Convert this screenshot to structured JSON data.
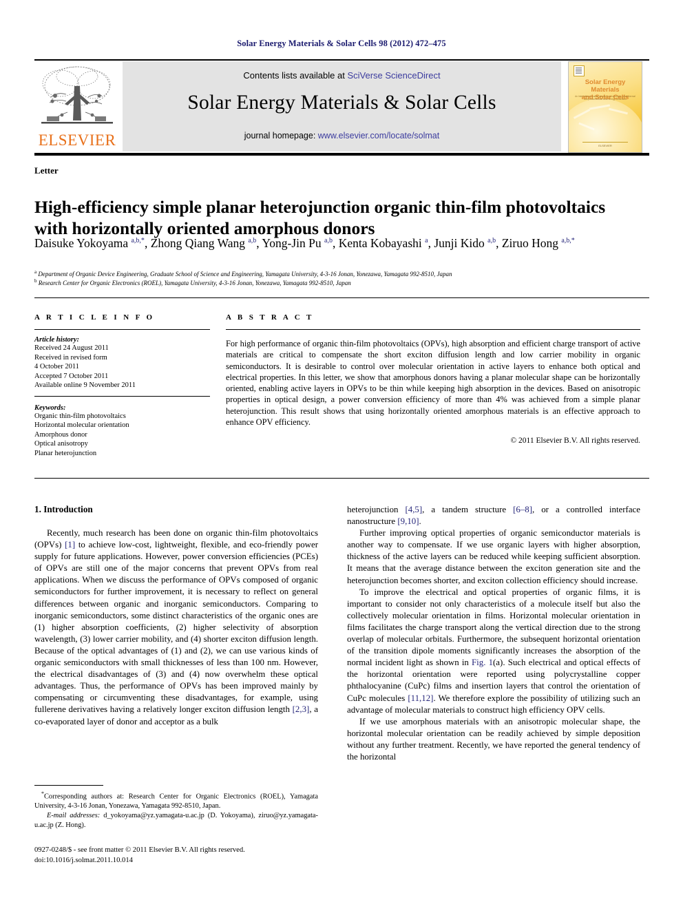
{
  "running_head": "Solar Energy Materials & Solar Cells 98 (2012) 472–475",
  "journal_header": {
    "contents_prefix": "Contents lists available at ",
    "contents_link": "SciVerse ScienceDirect",
    "journal_title": "Solar Energy Materials & Solar Cells",
    "homepage_prefix": "journal homepage: ",
    "homepage_link": "www.elsevier.com/locate/solmat",
    "publisher_wordmark": "ELSEVIER",
    "publisher_color": "#E8701A",
    "link_color": "#3b3b9e",
    "band_color": "#e3e3e3",
    "cover": {
      "title_line1": "Solar Energy Materials",
      "title_line2": "and Solar Cells",
      "subtitle": "An International Journal devoted to photovoltaic, photothermal and photochemical solar energy conversion",
      "footer": "ELSEVIER"
    }
  },
  "article": {
    "type_label": "Letter",
    "title": "High-efficiency simple planar heterojunction organic thin-film photovoltaics with horizontally oriented amorphous donors",
    "authors": [
      {
        "name": "Daisuke Yokoyama",
        "sup": "a,b,*"
      },
      {
        "name": "Zhong Qiang Wang",
        "sup": "a,b"
      },
      {
        "name": "Yong-Jin Pu",
        "sup": "a,b"
      },
      {
        "name": "Kenta Kobayashi",
        "sup": "a"
      },
      {
        "name": "Junji Kido",
        "sup": "a,b"
      },
      {
        "name": "Ziruo Hong",
        "sup": "a,b,*"
      }
    ],
    "affiliations": [
      {
        "marker": "a",
        "text": "Department of Organic Device Engineering, Graduate School of Science and Engineering, Yamagata University, 4-3-16 Jonan, Yonezawa, Yamagata 992-8510, Japan"
      },
      {
        "marker": "b",
        "text": "Research Center for Organic Electronics (ROEL), Yamagata University, 4-3-16 Jonan, Yonezawa, Yamagata 992-8510, Japan"
      }
    ]
  },
  "article_info": {
    "heading": "A R T I C L E   I N F O",
    "history_label": "Article history:",
    "history": [
      "Received 24 August 2011",
      "Received in revised form",
      "4 October 2011",
      "Accepted 7 October 2011",
      "Available online 9 November 2011"
    ],
    "keywords_label": "Keywords:",
    "keywords": [
      "Organic thin-film photovoltaics",
      "Horizontal molecular orientation",
      "Amorphous donor",
      "Optical anisotropy",
      "Planar heterojunction"
    ]
  },
  "abstract": {
    "heading": "A B S T R A C T",
    "text": "For high performance of organic thin-film photovoltaics (OPVs), high absorption and efficient charge transport of active materials are critical to compensate the short exciton diffusion length and low carrier mobility in organic semiconductors. It is desirable to control over molecular orientation in active layers to enhance both optical and electrical properties. In this letter, we show that amorphous donors having a planar molecular shape can be horizontally oriented, enabling active layers in OPVs to be thin while keeping high absorption in the devices. Based on anisotropic properties in optical design, a power conversion efficiency of more than 4% was achieved from a simple planar heterojunction. This result shows that using horizontally oriented amorphous materials is an effective approach to enhance OPV efficiency.",
    "copyright": "© 2011 Elsevier B.V. All rights reserved."
  },
  "body": {
    "section_heading": "1.  Introduction",
    "left_paragraphs": [
      {
        "segments": [
          {
            "t": "Recently, much research has been done on organic thin-film photovoltaics (OPVs) "
          },
          {
            "t": "[1]",
            "ref": true
          },
          {
            "t": " to achieve low-cost, lightweight, flexible, and eco-friendly power supply for future applications. However, power conversion efficiencies (PCEs) of OPVs are still one of the major concerns that prevent OPVs from real applications. When we discuss the performance of OPVs composed of organic semiconductors for further improvement, it is necessary to reflect on general differences between organic and inorganic semiconductors. Comparing to inorganic semiconductors, some distinct characteristics of the organic ones are (1) higher absorption coefficients, (2) higher selectivity of absorption wavelength, (3) lower carrier mobility, and (4) shorter exciton diffusion length. Because of the optical advantages of (1) and (2), we can use various kinds of organic semiconductors with small thicknesses of less than 100 nm. However, the electrical disadvantages of (3) and (4) now overwhelm these optical advantages. Thus, the performance of OPVs has been improved mainly by compensating or circumventing these disadvantages, for example, using fullerene derivatives having a relatively longer exciton diffusion length "
          },
          {
            "t": "[2,3]",
            "ref": true
          },
          {
            "t": ", a co-evaporated layer of donor and acceptor as a bulk"
          }
        ]
      }
    ],
    "right_paragraphs": [
      {
        "indent": false,
        "segments": [
          {
            "t": "heterojunction "
          },
          {
            "t": "[4,5]",
            "ref": true
          },
          {
            "t": ", a tandem structure "
          },
          {
            "t": "[6–8]",
            "ref": true
          },
          {
            "t": ", or a controlled interface nanostructure "
          },
          {
            "t": "[9,10]",
            "ref": true
          },
          {
            "t": "."
          }
        ]
      },
      {
        "indent": true,
        "segments": [
          {
            "t": "Further improving optical properties of organic semiconductor materials is another way to compensate. If we use organic layers with higher absorption, thickness of the active layers can be reduced while keeping sufficient absorption. It means that the average distance between the exciton generation site and the heterojunction becomes shorter, and exciton collection efficiency should increase."
          }
        ]
      },
      {
        "indent": true,
        "segments": [
          {
            "t": "To improve the electrical and optical properties of organic films, it is important to consider not only characteristics of a molecule itself but also the collectively molecular orientation in films. Horizontal molecular orientation in films facilitates the charge transport along the vertical direction due to the strong overlap of molecular orbitals. Furthermore, the subsequent horizontal orientation of the transition dipole moments significantly increases the absorption of the normal incident light as shown in "
          },
          {
            "t": "Fig. 1",
            "ref": true
          },
          {
            "t": "(a). Such electrical and optical effects of the horizontal orientation were reported using polycrystalline copper phthalocyanine (CuPc) films and insertion layers that control the orientation of CuPc molecules "
          },
          {
            "t": "[11,12]",
            "ref": true
          },
          {
            "t": ". We therefore explore the possibility of utilizing such an advantage of molecular materials to construct high efficiency OPV cells."
          }
        ]
      },
      {
        "indent": true,
        "segments": [
          {
            "t": "If we use amorphous materials with an anisotropic molecular shape, the horizontal molecular orientation can be readily achieved by simple deposition without any further treatment. Recently, we have reported the general tendency of the horizontal"
          }
        ]
      }
    ]
  },
  "footnote": {
    "corresponding": "Corresponding authors at: Research Center for Organic Electronics (ROEL), Yamagata University, 4-3-16 Jonan, Yonezawa, Yamagata 992-8510, Japan.",
    "email_label": "E-mail addresses:",
    "emails": "d_yokoyama@yz.yamagata-u.ac.jp (D. Yokoyama), ziruo@yz.yamagata-u.ac.jp (Z. Hong).",
    "issn_line": "0927-0248/$ - see front matter © 2011 Elsevier B.V. All rights reserved.",
    "doi_line": "doi:10.1016/j.solmat.2011.10.014"
  }
}
